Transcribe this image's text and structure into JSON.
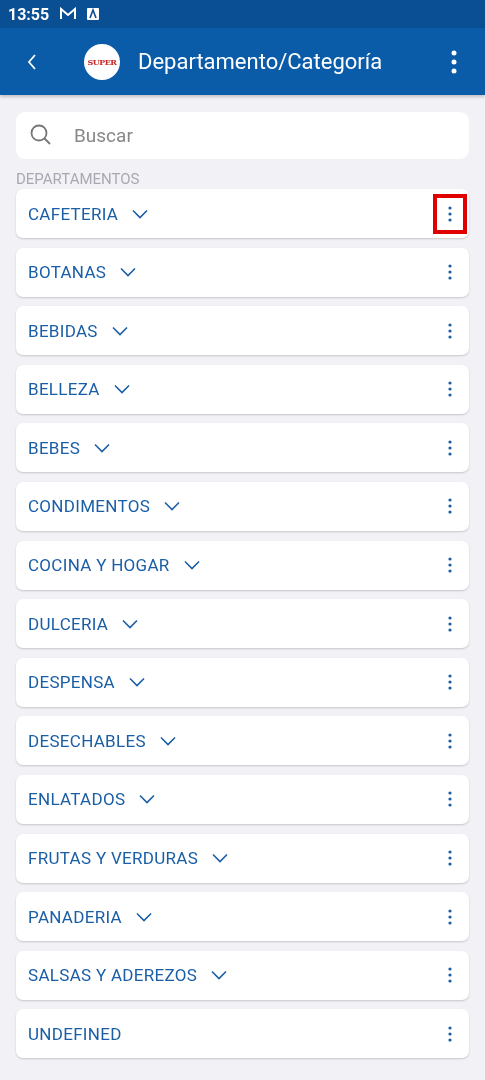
{
  "status_bar": {
    "time": "13:55"
  },
  "app_bar": {
    "title": "Departamento/Categoría",
    "logo_text": "SUPER"
  },
  "search": {
    "placeholder": "Buscar"
  },
  "section_label": "DEPARTAMENTOS",
  "departments": [
    {
      "label": "CAFETERIA",
      "expandable": true,
      "highlighted": true
    },
    {
      "label": "BOTANAS",
      "expandable": true,
      "highlighted": false
    },
    {
      "label": "BEBIDAS",
      "expandable": true,
      "highlighted": false
    },
    {
      "label": "BELLEZA",
      "expandable": true,
      "highlighted": false
    },
    {
      "label": "BEBES",
      "expandable": true,
      "highlighted": false
    },
    {
      "label": "CONDIMENTOS",
      "expandable": true,
      "highlighted": false
    },
    {
      "label": "COCINA Y HOGAR",
      "expandable": true,
      "highlighted": false
    },
    {
      "label": "DULCERIA",
      "expandable": true,
      "highlighted": false
    },
    {
      "label": "DESPENSA",
      "expandable": true,
      "highlighted": false
    },
    {
      "label": "DESECHABLES",
      "expandable": true,
      "highlighted": false
    },
    {
      "label": "ENLATADOS",
      "expandable": true,
      "highlighted": false
    },
    {
      "label": "FRUTAS Y VERDURAS",
      "expandable": true,
      "highlighted": false
    },
    {
      "label": "PANADERIA",
      "expandable": true,
      "highlighted": false
    },
    {
      "label": "SALSAS Y ADEREZOS",
      "expandable": true,
      "highlighted": false
    },
    {
      "label": "UNDEFINED",
      "expandable": false,
      "highlighted": false
    }
  ]
}
